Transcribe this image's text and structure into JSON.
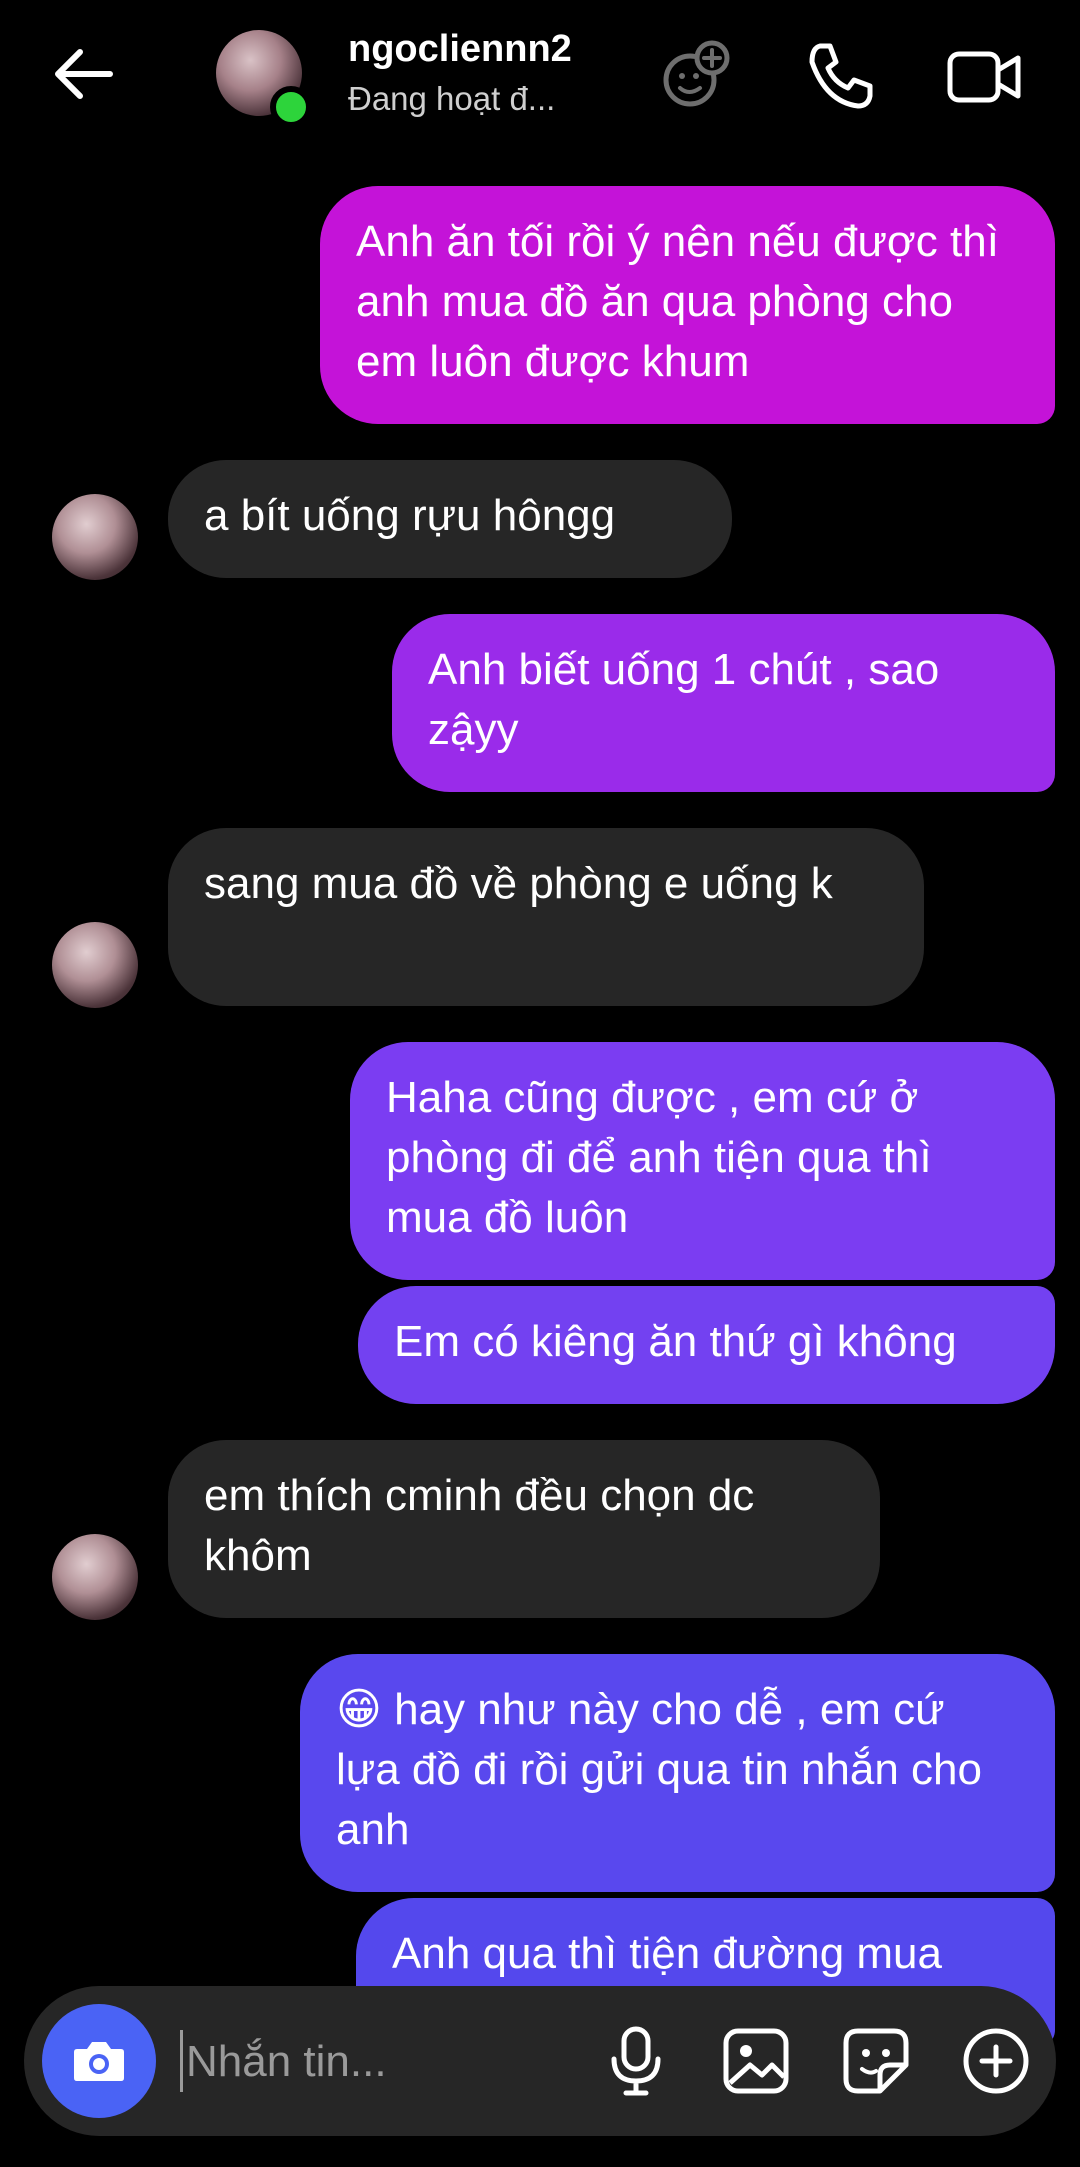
{
  "header": {
    "username": "ngocliennn2",
    "status": "Đang hoạt đ..."
  },
  "colors": {
    "out_1": "#c413d8",
    "out_2": "#9a2bea",
    "out_3": "#7b3df2",
    "out_4": "#6a43f0",
    "out_5": "#5948ee",
    "incoming": "#262626",
    "online": "#2dd43b",
    "camera": "#4a63f5"
  },
  "messages": [
    {
      "dir": "out",
      "text": "Anh ăn tối rồi ý nên nếu được thì anh mua đồ ăn qua phòng cho em luôn được khum"
    },
    {
      "dir": "in",
      "text": "a bít uống rựu hôngg"
    },
    {
      "dir": "out",
      "text": "Anh biết uống 1 chút , sao zậyy"
    },
    {
      "dir": "in",
      "text": "sang mua đồ về phòng e uống k"
    },
    {
      "dir": "out",
      "text": "Haha cũng được , em cứ ở phòng đi để anh tiện qua thì mua đồ luôn"
    },
    {
      "dir": "out",
      "text": "Em có kiêng ăn thứ gì không"
    },
    {
      "dir": "in",
      "text": "em thích cminh đều chọn dc khôm"
    },
    {
      "dir": "out",
      "text": "😁 hay như này cho dễ , em cứ lựa đồ đi rồi gửi qua tin nhắn cho anh"
    },
    {
      "dir": "out",
      "text": "Anh qua thì tiện đường mua"
    }
  ],
  "composer": {
    "placeholder": "Nhắn tin..."
  },
  "icons": {
    "back": "back-arrow-icon",
    "effects": "add-effect-icon",
    "call": "phone-icon",
    "video": "video-camera-icon",
    "camera": "camera-icon",
    "mic": "microphone-icon",
    "gallery": "image-icon",
    "sticker": "sticker-icon",
    "more": "plus-circle-icon"
  }
}
